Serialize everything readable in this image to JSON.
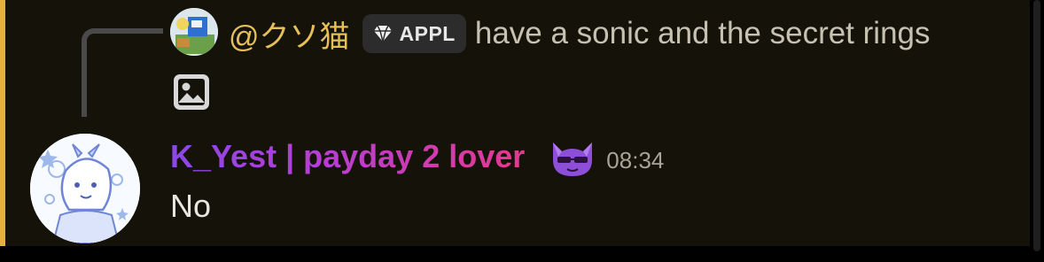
{
  "reply": {
    "author": "@クソ猫",
    "tag_label": "APPL",
    "text": "have a sonic and the secret rings",
    "attachment_icon": "image-icon",
    "badge_icon": "gem-icon"
  },
  "message": {
    "author": "K_Yest | payday 2 lover",
    "timestamp": "08:34",
    "content": "No",
    "role_icon": "purple-cat-emoji"
  },
  "colors": {
    "highlight": "#e2b33b",
    "reply_author": "#e5bf5a",
    "username_gradient": [
      "#8b47e8",
      "#e33a8e"
    ],
    "background": "#15120a"
  }
}
